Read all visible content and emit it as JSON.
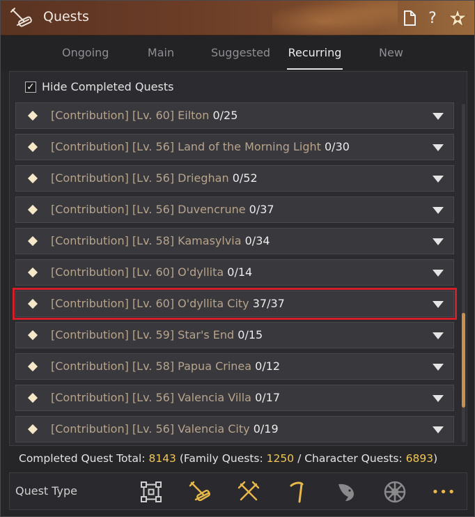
{
  "window": {
    "title": "Quests"
  },
  "tabs": [
    {
      "label": "Ongoing",
      "active": false
    },
    {
      "label": "Main",
      "active": false
    },
    {
      "label": "Suggested",
      "active": false
    },
    {
      "label": "Recurring",
      "active": true
    },
    {
      "label": "New",
      "active": false
    }
  ],
  "filter": {
    "hide_completed_label": "Hide Completed Quests",
    "checked": true,
    "check_glyph": "✓"
  },
  "quests": [
    {
      "name": "[Contribution] [Lv. 60] Eilton",
      "count": "0/25"
    },
    {
      "name": "[Contribution] [Lv. 56] Land of the Morning Light",
      "count": "0/30"
    },
    {
      "name": "[Contribution] [Lv. 56] Drieghan",
      "count": "0/52"
    },
    {
      "name": "[Contribution] [Lv. 56] Duvencrune",
      "count": "0/37"
    },
    {
      "name": "[Contribution] [Lv. 58] Kamasylvia",
      "count": "0/34"
    },
    {
      "name": "[Contribution] [Lv. 60] O'dyllita",
      "count": "0/14"
    },
    {
      "name": "[Contribution] [Lv. 60] O'dyllita City",
      "count": "37/37",
      "highlighted": true
    },
    {
      "name": "[Contribution] [Lv. 59] Star's End",
      "count": "0/15"
    },
    {
      "name": "[Contribution] [Lv. 58] Papua Crinea",
      "count": "0/12"
    },
    {
      "name": "[Contribution] [Lv. 56] Valencia Villa",
      "count": "0/17"
    },
    {
      "name": "[Contribution] [Lv. 56] Valencia City",
      "count": "0/19"
    }
  ],
  "totals": {
    "completed_label": "Completed Quest Total:",
    "completed_value": "8143",
    "family_label": "(Family Quests:",
    "family_value": "1250",
    "separator": "/",
    "character_label": "Character Quests:",
    "character_value": "6893",
    "close_paren": ")"
  },
  "footer": {
    "label": "Quest Type",
    "icons": [
      "grid-icon",
      "scroll-quill-icon",
      "crossed-swords-icon",
      "pickaxe-icon",
      "fish-icon",
      "wheel-icon",
      "more-icon"
    ],
    "more_glyph": "•••"
  },
  "titlebar_buttons": {
    "help_glyph": "?"
  },
  "colors": {
    "accent_orange": "#c98f4f",
    "highlight_red": "#d1202a",
    "gold_text": "#f0c755",
    "quest_label": "#b7a48c",
    "titlebar": "#6b3d27"
  },
  "scroll": {
    "position": 0.62,
    "visible_fraction": 0.28
  }
}
